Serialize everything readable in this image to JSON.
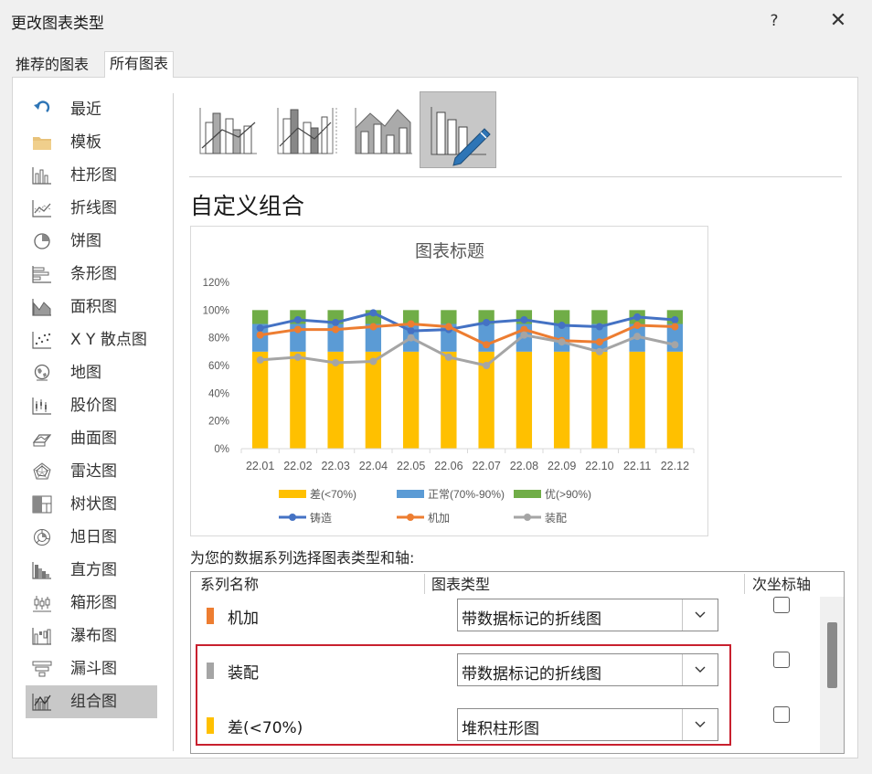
{
  "dialog": {
    "title": "更改图表类型",
    "help_label": "?",
    "close_label": "✕"
  },
  "tabs": [
    {
      "label": "推荐的图表",
      "selected": false
    },
    {
      "label": "所有图表",
      "selected": true
    }
  ],
  "nav": {
    "items": [
      {
        "label": "最近",
        "icon": "recent-icon"
      },
      {
        "label": "模板",
        "icon": "folder-icon"
      },
      {
        "label": "柱形图",
        "icon": "column-chart-icon"
      },
      {
        "label": "折线图",
        "icon": "line-chart-icon"
      },
      {
        "label": "饼图",
        "icon": "pie-chart-icon"
      },
      {
        "label": "条形图",
        "icon": "bar-chart-icon"
      },
      {
        "label": "面积图",
        "icon": "area-chart-icon"
      },
      {
        "label": "X Y 散点图",
        "icon": "scatter-chart-icon"
      },
      {
        "label": "地图",
        "icon": "map-chart-icon"
      },
      {
        "label": "股价图",
        "icon": "stock-chart-icon"
      },
      {
        "label": "曲面图",
        "icon": "surface-chart-icon"
      },
      {
        "label": "雷达图",
        "icon": "radar-chart-icon"
      },
      {
        "label": "树状图",
        "icon": "treemap-chart-icon"
      },
      {
        "label": "旭日图",
        "icon": "sunburst-chart-icon"
      },
      {
        "label": "直方图",
        "icon": "histogram-chart-icon"
      },
      {
        "label": "箱形图",
        "icon": "box-whisker-chart-icon"
      },
      {
        "label": "瀑布图",
        "icon": "waterfall-chart-icon"
      },
      {
        "label": "漏斗图",
        "icon": "funnel-chart-icon"
      },
      {
        "label": "组合图",
        "icon": "combo-chart-icon"
      }
    ],
    "selected_index": 18
  },
  "subtypes": {
    "icons": [
      "clustered-column-line-icon",
      "clustered-column-line-secondary-icon",
      "stacked-area-column-icon",
      "custom-combo-icon"
    ],
    "selected_index": 3
  },
  "section_title": "自定义组合",
  "chart_data": {
    "type": "bar",
    "title": "图表标题",
    "categories": [
      "22.01",
      "22.02",
      "22.03",
      "22.04",
      "22.05",
      "22.06",
      "22.07",
      "22.08",
      "22.09",
      "22.10",
      "22.11",
      "22.12"
    ],
    "ylim": [
      0,
      120
    ],
    "yticks": [
      "0%",
      "20%",
      "40%",
      "60%",
      "80%",
      "100%",
      "120%"
    ],
    "grid": false,
    "legend_position": "bottom",
    "stacked_series": [
      {
        "name": "差(<70%)",
        "color": "#ffc000",
        "values": [
          70,
          70,
          70,
          70,
          70,
          70,
          70,
          70,
          70,
          70,
          70,
          70
        ]
      },
      {
        "name": "正常(70%-90%)",
        "color": "#5b9bd5",
        "values": [
          20,
          20,
          20,
          20,
          20,
          20,
          20,
          20,
          20,
          20,
          20,
          20
        ]
      },
      {
        "name": "优(>90%)",
        "color": "#70ad47",
        "values": [
          10,
          10,
          10,
          10,
          10,
          10,
          10,
          10,
          10,
          10,
          10,
          10
        ]
      }
    ],
    "line_series": [
      {
        "name": "铸造",
        "color": "#4472c4",
        "values": [
          87,
          93,
          91,
          98,
          85,
          86,
          91,
          93,
          89,
          88,
          95,
          93
        ]
      },
      {
        "name": "机加",
        "color": "#ed7d31",
        "values": [
          82,
          86,
          86,
          88,
          90,
          88,
          75,
          86,
          78,
          77,
          89,
          88
        ]
      },
      {
        "name": "装配",
        "color": "#a5a5a5",
        "values": [
          64,
          66,
          62,
          63,
          80,
          66,
          60,
          82,
          77,
          70,
          81,
          75
        ]
      }
    ]
  },
  "series_prompt": "为您的数据系列选择图表类型和轴:",
  "series_table": {
    "headers": {
      "name": "系列名称",
      "type": "图表类型",
      "secondary": "次坐标轴"
    },
    "rows": [
      {
        "name": "机加",
        "color": "#ed7d31",
        "chart_type": "带数据标记的折线图",
        "secondary_axis": false
      },
      {
        "name": "装配",
        "color": "#a5a5a5",
        "chart_type": "带数据标记的折线图",
        "secondary_axis": false
      },
      {
        "name": "差(<70%)",
        "color": "#ffc000",
        "chart_type": "堆积柱形图",
        "secondary_axis": false
      }
    ]
  }
}
